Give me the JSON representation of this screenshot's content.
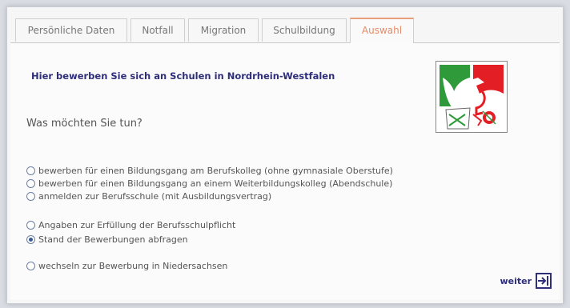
{
  "tabs": [
    {
      "label": "Persönliche Daten",
      "active": false
    },
    {
      "label": "Notfall",
      "active": false
    },
    {
      "label": "Migration",
      "active": false
    },
    {
      "label": "Schulbildung",
      "active": false
    },
    {
      "label": "Auswahl",
      "active": true
    }
  ],
  "main": {
    "heading": "Hier bewerben Sie sich an Schulen in Nordrhein-Westfalen",
    "question": "Was möchten Sie tun?",
    "options": [
      {
        "label": "bewerben für einen Bildungsgang am Berufskolleg (ohne gymnasiale Oberstufe)",
        "checked": false
      },
      {
        "label": "bewerben für einen Bildungsgang an einem Weiterbildungskolleg (Abendschule)",
        "checked": false
      },
      {
        "label": "anmelden zur Berufsschule (mit Ausbildungsvertrag)",
        "checked": false
      },
      {
        "label": "Angaben zur Erfüllung der Berufsschulpflicht",
        "checked": false
      },
      {
        "label": "Stand der Bewerbungen abfragen",
        "checked": true
      },
      {
        "label": "wechseln zur Bewerbung in Niedersachsen",
        "checked": false
      }
    ],
    "next_label": "weiter"
  },
  "colors": {
    "active_tab": "#e68b66",
    "heading": "#2f2e7a",
    "logo_green": "#2e9a3a",
    "logo_red": "#e31e24"
  },
  "icons": {
    "logo": "nrw-coat-of-arms",
    "next": "arrow-into-box-icon"
  }
}
